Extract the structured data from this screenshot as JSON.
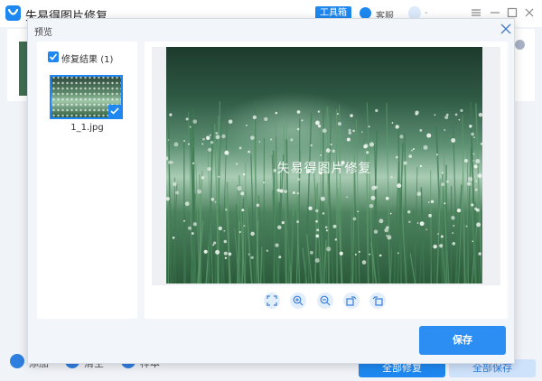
{
  "app": {
    "title": "失易得图片修复",
    "toolbox_label": "工具箱",
    "kefu_label": "客服",
    "user_suffix": "-"
  },
  "bottom": {
    "add_label": "添加",
    "clear_label": "清空",
    "sample_label": "样本",
    "repair_all_label": "全部修复",
    "save_all_label": "全部保存"
  },
  "modal": {
    "title": "预览",
    "result_label": "修复结果",
    "result_count": "(1)",
    "file_name": "1_1.jpg",
    "watermark": "失易得图片修复",
    "save_label": "保存",
    "controls": [
      "fit-screen-icon",
      "zoom-in-icon",
      "zoom-out-icon",
      "rotate-right-icon",
      "rotate-left-icon"
    ]
  },
  "colors": {
    "accent": "#1e88f0",
    "save_button": "#2c8df2",
    "modal_bg": "#f2f5f9"
  }
}
